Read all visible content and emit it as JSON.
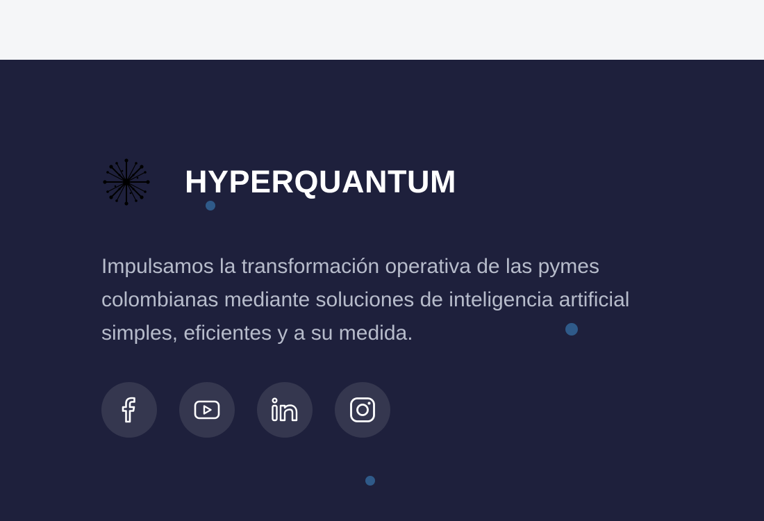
{
  "brand": {
    "name": "HYPERQUANTUM",
    "logo_icon": "starburst-network-icon"
  },
  "tagline": "Impulsamos la transformación operativa de las pymes colombianas mediante soluciones de inteligencia artificial simples, eficientes y a su medida.",
  "socials": [
    {
      "icon": "facebook-icon"
    },
    {
      "icon": "youtube-icon"
    },
    {
      "icon": "linkedin-icon"
    },
    {
      "icon": "instagram-icon"
    }
  ],
  "colors": {
    "top_background": "#f5f6f8",
    "footer_background": "#1e203c",
    "social_circle": "#35374f",
    "tagline_text": "#b7bccb",
    "particle": "#2f5a89"
  }
}
